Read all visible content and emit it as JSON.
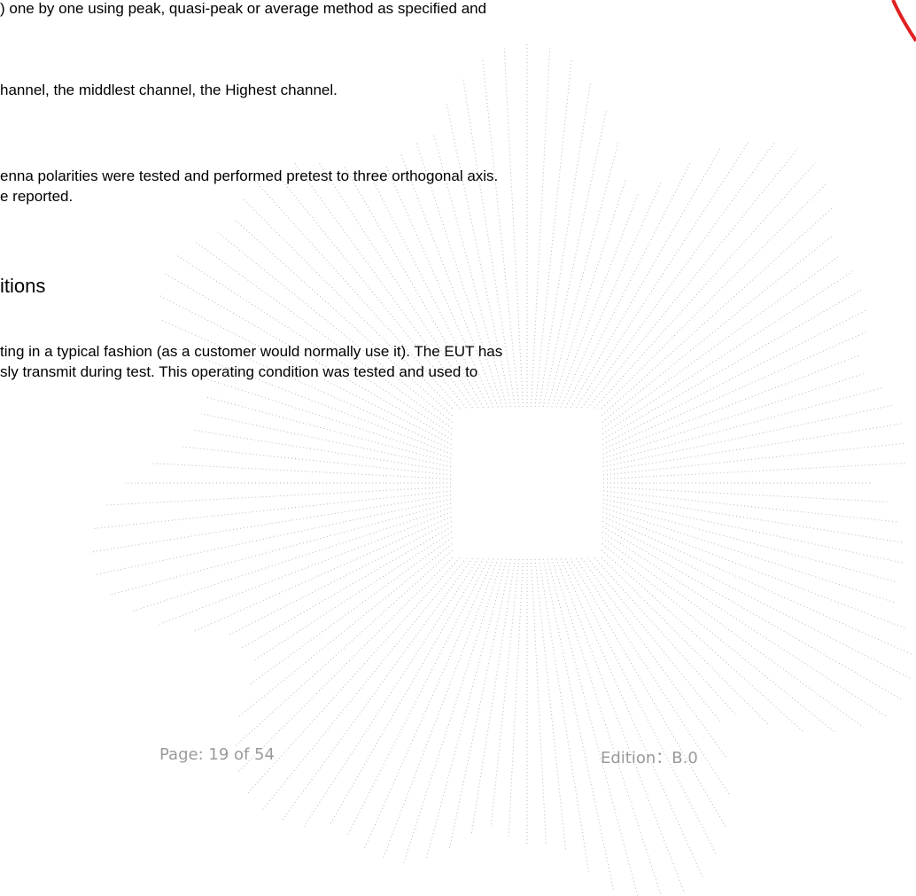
{
  "document": {
    "paragraph1": ") one by one using peak, quasi-peak or average method as specified and",
    "paragraph2": "hannel, the middlest channel, the Highest channel.",
    "paragraph3_line1": "enna polarities were tested and performed pretest to three orthogonal axis.",
    "paragraph3_line2": "e reported.",
    "section_heading": "itions",
    "paragraph4_line1": "ting in a typical fashion (as a customer would normally use it). The EUT has",
    "paragraph4_line2": "sly transmit during test. This operating condition was tested and used to"
  },
  "footer": {
    "page": "Page: 19 of 54",
    "edition": "Edition：B.0"
  },
  "colors": {
    "text": "#000000",
    "footer_text": "#9a9a9a",
    "watermark_dots": "#b8b8b8",
    "stamp_red": "#e02020"
  },
  "watermark": {
    "type": "dotted-radial-burst",
    "icon": "starburst-watermark-icon"
  },
  "stamp": {
    "type": "red-seal-edge",
    "icon": "seal-stamp-icon"
  }
}
